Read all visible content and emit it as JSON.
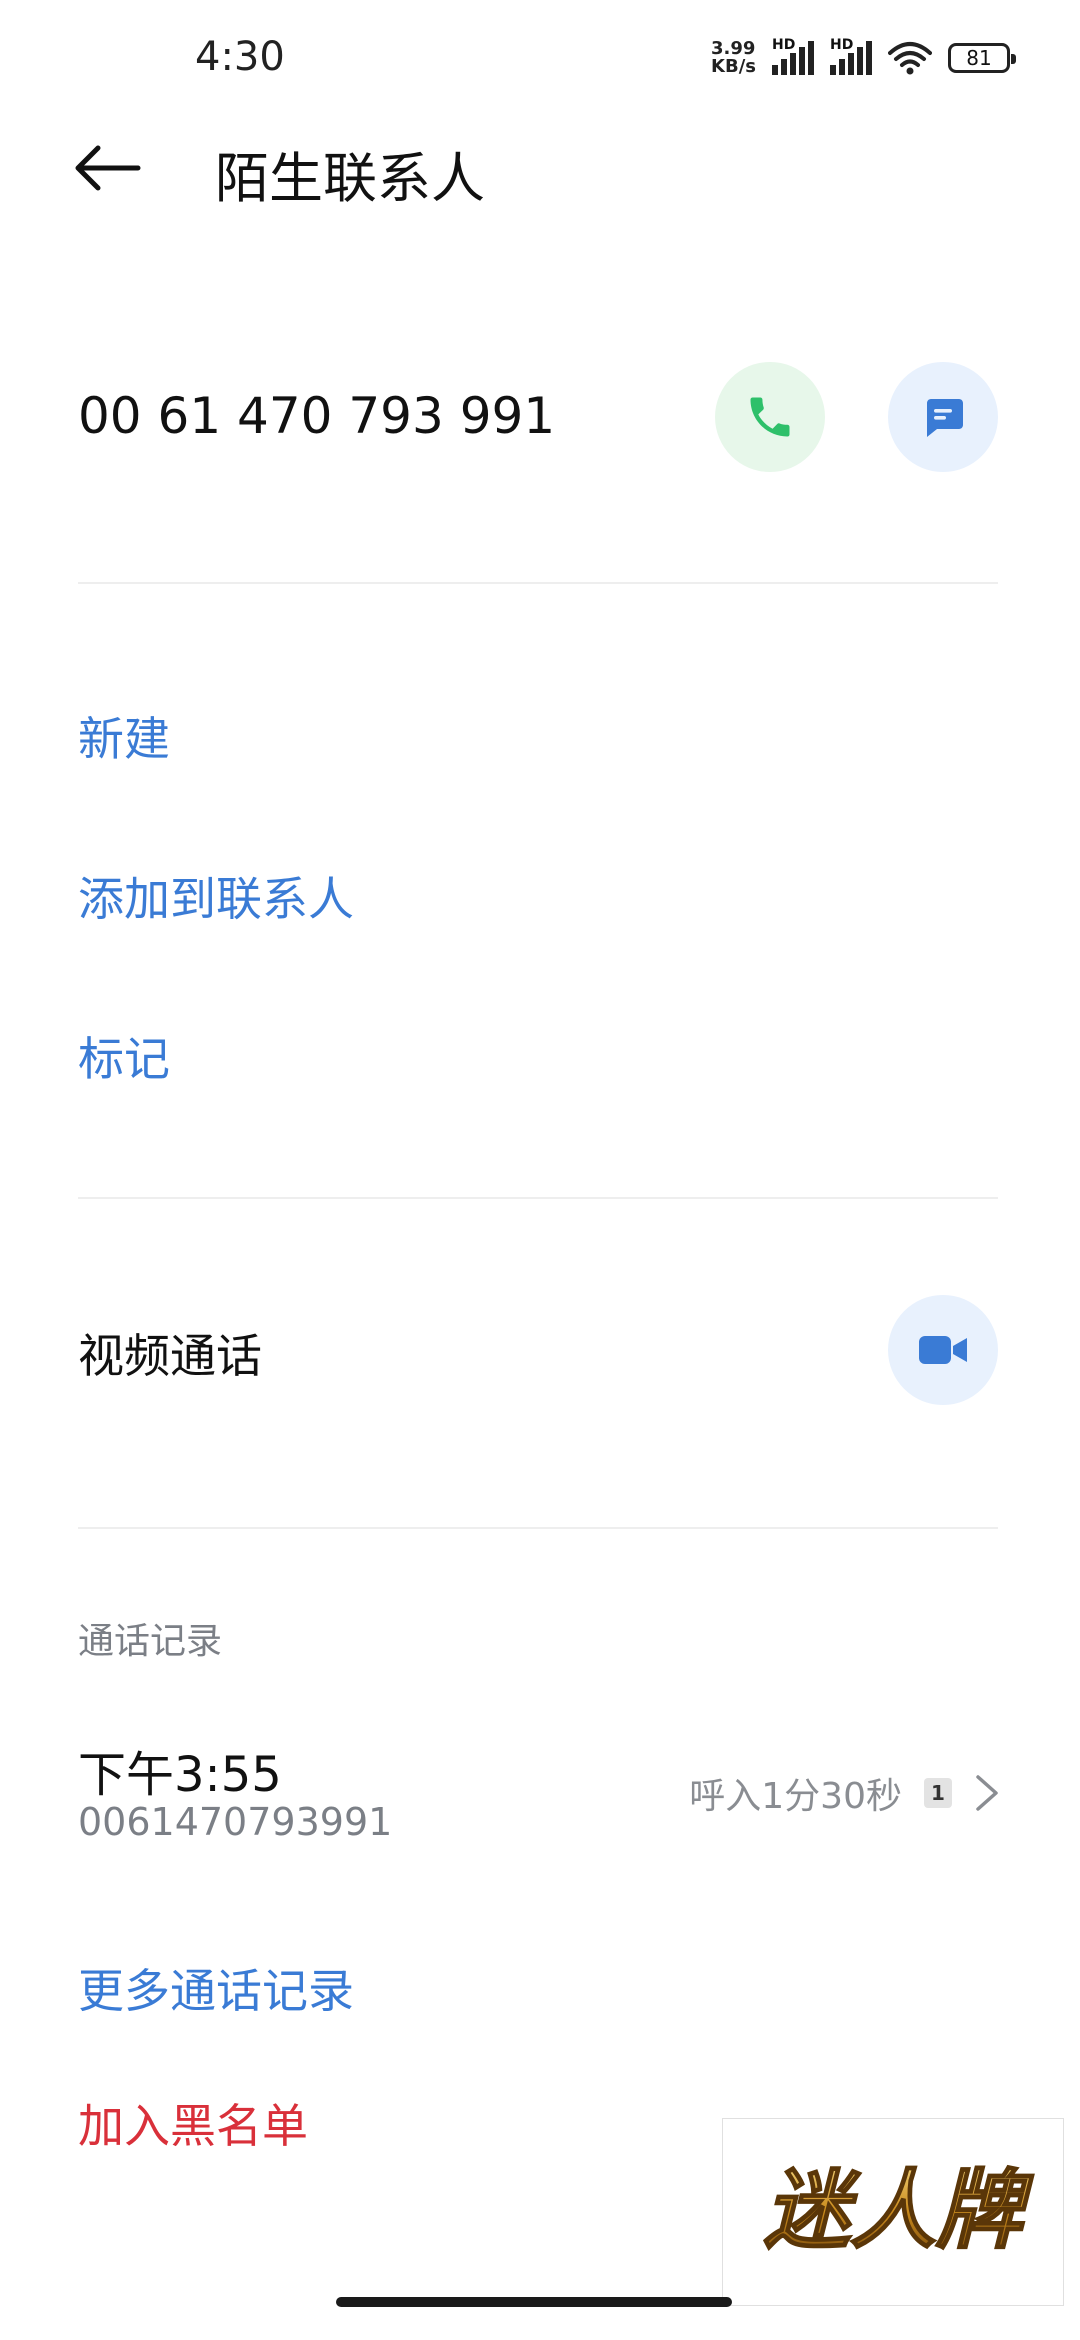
{
  "status_bar": {
    "time": "4:30",
    "net_speed_value": "3.99",
    "net_speed_unit": "KB/s",
    "sim1_label": "HD",
    "sim2_label": "HD",
    "battery": "81"
  },
  "header": {
    "title": "陌生联系人",
    "back_icon": "arrow-left-icon"
  },
  "contact": {
    "number": "00 61 470 793 991",
    "call_icon": "phone-icon",
    "message_icon": "message-icon",
    "colors": {
      "call_bg": "#e7f7ea",
      "call_fg": "#2ec06a",
      "msg_bg": "#e8f1fd",
      "msg_fg": "#3a7bd5"
    }
  },
  "actions": [
    {
      "label": "新建"
    },
    {
      "label": "添加到联系人"
    },
    {
      "label": "标记"
    }
  ],
  "video_call": {
    "label": "视频通话",
    "icon": "video-camera-icon"
  },
  "call_log": {
    "section_title": "通话记录",
    "entry": {
      "time": "下午3:55",
      "number": "0061470793991",
      "description": "呼入1分30秒",
      "sim": "1"
    },
    "more_label": "更多通话记录"
  },
  "blacklist_label": "加入黑名单",
  "watermark": {
    "text": "迷人牌"
  },
  "colors": {
    "link": "#3a7bd5",
    "danger": "#d9303a"
  }
}
